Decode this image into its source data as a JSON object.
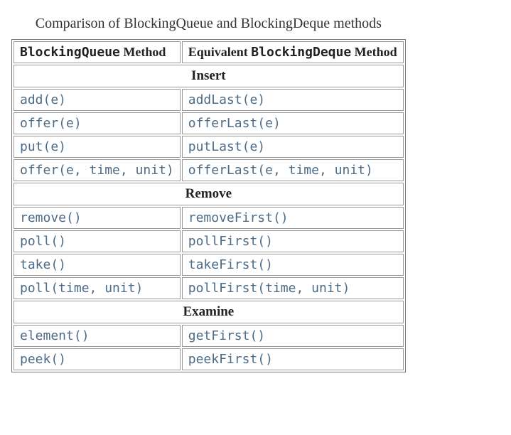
{
  "caption": "Comparison of BlockingQueue and BlockingDeque methods",
  "header": {
    "col1_prefix_code": "BlockingQueue",
    "col1_suffix": " Method",
    "col2_prefix": "Equivalent ",
    "col2_code": "BlockingDeque",
    "col2_suffix": " Method"
  },
  "sections": {
    "insert": "Insert",
    "remove": "Remove",
    "examine": "Examine"
  },
  "rows": {
    "insert": [
      {
        "q": "add(e)",
        "d": "addLast(e)"
      },
      {
        "q": "offer(e)",
        "d": "offerLast(e)"
      },
      {
        "q": "put(e)",
        "d": "putLast(e)"
      },
      {
        "q": "offer(e, time, unit)",
        "d": "offerLast(e, time, unit)"
      }
    ],
    "remove": [
      {
        "q": "remove()",
        "d": "removeFirst()"
      },
      {
        "q": "poll()",
        "d": "pollFirst()"
      },
      {
        "q": "take()",
        "d": "takeFirst()"
      },
      {
        "q": "poll(time, unit)",
        "d": "pollFirst(time, unit)"
      }
    ],
    "examine": [
      {
        "q": "element()",
        "d": "getFirst()"
      },
      {
        "q": "peek()",
        "d": "peekFirst()"
      }
    ]
  }
}
